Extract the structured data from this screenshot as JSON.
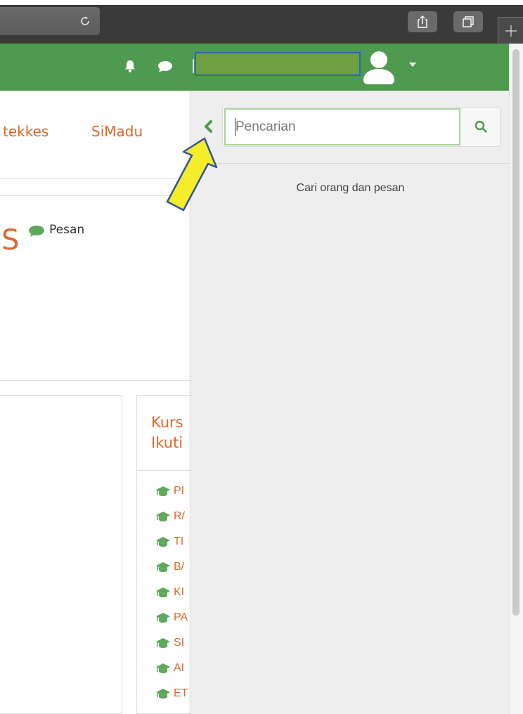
{
  "browser": {
    "reload_icon": "reload-icon",
    "share_icon": "share-icon",
    "tabs_icon": "tabs-icon",
    "new_tab_icon": "plus-icon"
  },
  "header": {
    "notifications_icon": "bell-icon",
    "messages_icon": "chat-bubble-icon",
    "user_menu_icon": "user-avatar-icon",
    "dropdown_icon": "caret-down-icon",
    "bg_color": "#4e9a4f"
  },
  "nav": {
    "links": [
      {
        "label": "tekkes"
      },
      {
        "label": "SiMadu"
      }
    ]
  },
  "profile": {
    "title_fragment": "S",
    "message_link": "Pesan"
  },
  "courses": {
    "title": "Kurs\nIkuti",
    "items": [
      {
        "label": "PI"
      },
      {
        "label": "R/"
      },
      {
        "label": "TI"
      },
      {
        "label": "B/"
      },
      {
        "label": "KI"
      },
      {
        "label": "PA"
      },
      {
        "label": "SI"
      },
      {
        "label": "AI"
      },
      {
        "label": "ET"
      }
    ]
  },
  "drawer": {
    "search_placeholder": "Pencarian",
    "search_value": "",
    "hint": "Cari orang dan pesan",
    "accent_color": "#4e9a4f"
  },
  "colors": {
    "link_orange": "#e0662b",
    "arrow_yellow": "#f5ec2a",
    "arrow_outline": "#2f5597"
  }
}
